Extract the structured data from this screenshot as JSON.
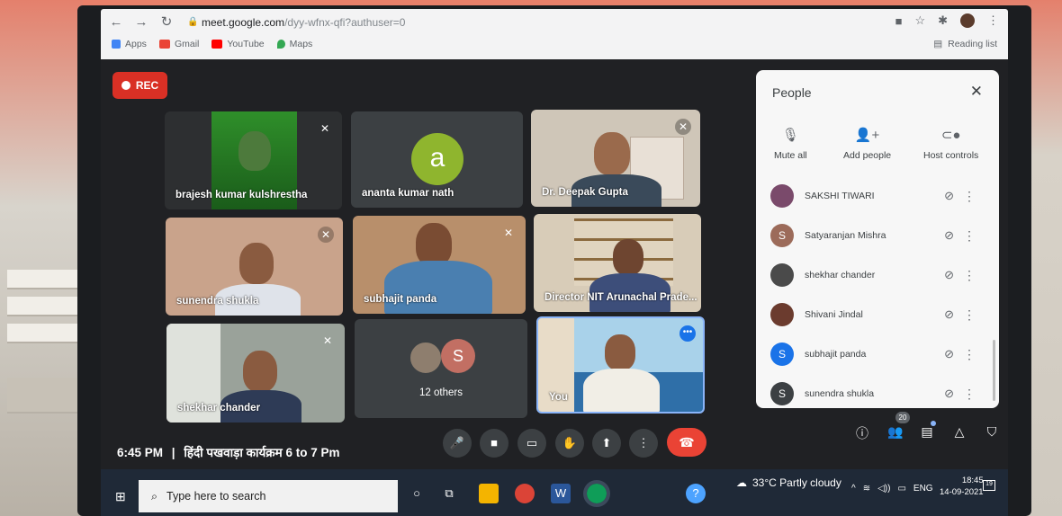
{
  "browser": {
    "url_main": "meet.google.com",
    "url_path": "/dyy-wfnx-qfi?authuser=0",
    "bookmarks": [
      {
        "label": "Apps",
        "icon": "apps-grid-icon"
      },
      {
        "label": "Gmail",
        "icon": "gmail-icon"
      },
      {
        "label": "YouTube",
        "icon": "youtube-icon"
      },
      {
        "label": "Maps",
        "icon": "maps-icon"
      }
    ],
    "reading_list": "Reading list"
  },
  "meet": {
    "rec_label": "REC",
    "tiles": [
      {
        "name": "brajesh kumar kulshrestha"
      },
      {
        "name": "ananta kumar nath",
        "avatar_letter": "a"
      },
      {
        "name": "Dr. Deepak Gupta"
      },
      {
        "name": "sunendra shukla"
      },
      {
        "name": "subhajit panda"
      },
      {
        "name": "Director NIT Arunachal Prade..."
      },
      {
        "name": "shekhar chander"
      },
      {
        "name": "12 others",
        "avatar_letter": "S"
      },
      {
        "name": "You"
      }
    ],
    "meeting_time": "6:45 PM",
    "meeting_title": "हिंदी पखवाड़ा कार्यक्रम 6 to 7 Pm",
    "participant_count": "20"
  },
  "people_panel": {
    "title": "People",
    "controls": [
      {
        "label": "Mute all"
      },
      {
        "label": "Add people"
      },
      {
        "label": "Host controls"
      }
    ],
    "participants": [
      {
        "name": "SAKSHI TIWARI",
        "avatar": "photo",
        "color": "#7a4a6b"
      },
      {
        "name": "Satyaranjan Mishra",
        "avatar": "S",
        "color": "#9c6b5a"
      },
      {
        "name": "shekhar chander",
        "avatar": "photo",
        "color": "#4a4a4a"
      },
      {
        "name": "Shivani Jindal",
        "avatar": "photo",
        "color": "#6b3b2e"
      },
      {
        "name": "subhajit panda",
        "avatar": "S",
        "color": "#1a73e8"
      },
      {
        "name": "sunendra shukla",
        "avatar": "S",
        "color": "#3c4043"
      }
    ]
  },
  "taskbar": {
    "search_placeholder": "Type here to search",
    "weather": "33°C  Partly cloudy",
    "lang": "ENG",
    "time": "18:45",
    "date": "14-09-2021",
    "notifications": "19"
  }
}
